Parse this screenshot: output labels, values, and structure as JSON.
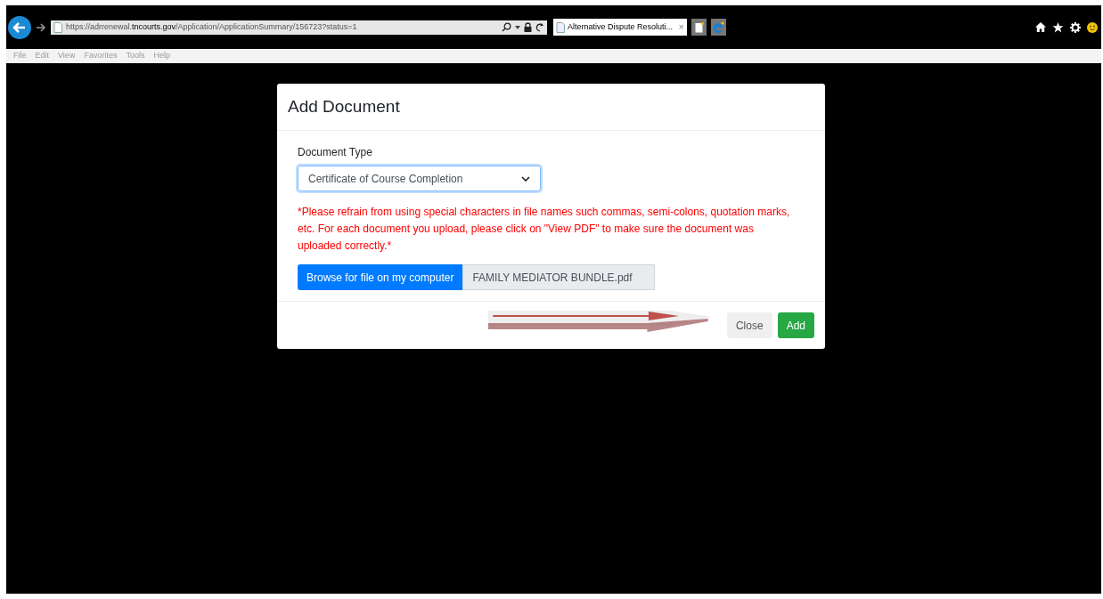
{
  "browser": {
    "url_parts": [
      {
        "text": "https://adrrenewal.",
        "strong": false
      },
      {
        "text": "tncourts.gov",
        "strong": true
      },
      {
        "text": "/Application/ApplicationSummary/156723?status=1",
        "strong": false
      }
    ],
    "tabs": [
      {
        "title": "Alternative Dispute Resoluti...",
        "selected": true,
        "close": "×"
      }
    ],
    "menu": [
      "File",
      "Edit",
      "View",
      "Favorites",
      "Tools",
      "Help"
    ]
  },
  "modal": {
    "title": "Add Document",
    "field_label": "Document Type",
    "select_value": "Certificate of Course Completion",
    "warning": "*Please refrain from using special characters in file names such commas, semi-colons, quotation marks, etc. For each document you upload, please click on \"View PDF\" to make sure the document was uploaded correctly.*",
    "browse_button": "Browse for file on my computer",
    "file_name": "FAMILY MEDIATOR BUNDLE.pdf",
    "buttons": [
      {
        "label": "Close",
        "kind": "secondary"
      },
      {
        "label": "Add",
        "kind": "primary"
      }
    ]
  }
}
